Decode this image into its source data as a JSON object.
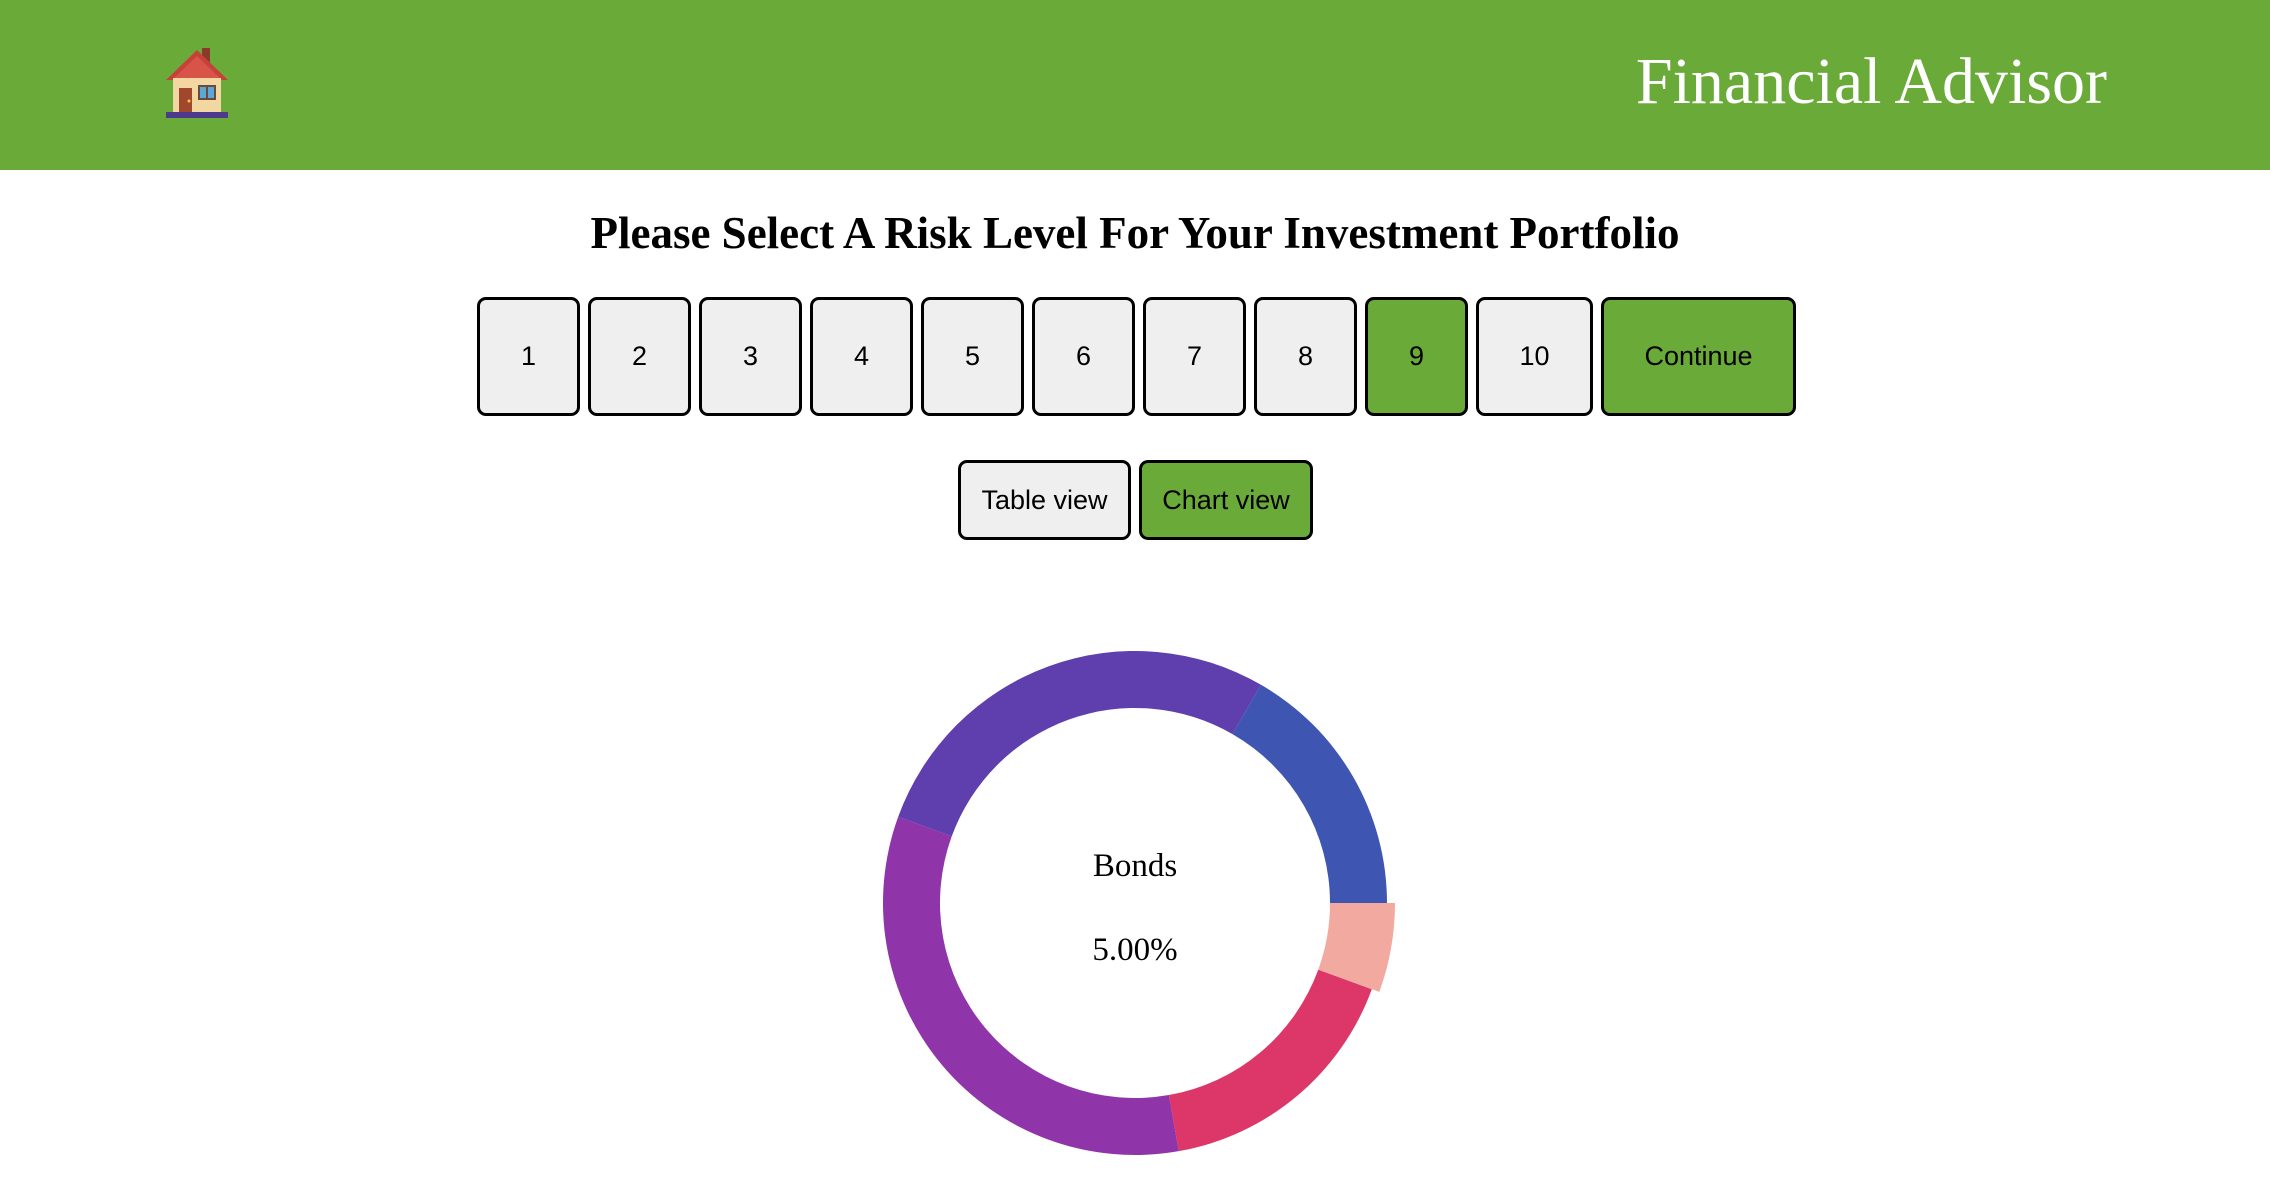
{
  "header": {
    "title": "Financial Advisor",
    "home_icon": "house-icon",
    "background_color": "#6aaa38"
  },
  "prompt": "Please Select A Risk Level For Your Investment Portfolio",
  "risk_levels": [
    "1",
    "2",
    "3",
    "4",
    "5",
    "6",
    "7",
    "8",
    "9",
    "10"
  ],
  "selected_risk_level": "9",
  "continue_label": "Continue",
  "views": {
    "table_label": "Table view",
    "chart_label": "Chart view",
    "active": "chart"
  },
  "chart_data": {
    "type": "pie",
    "style": "donut",
    "center_label": "Bonds",
    "center_value": "5.00%",
    "slices": [
      {
        "value": 5,
        "color": "#f2aaa0",
        "highlighted": true
      },
      {
        "value": 15,
        "color": "#dc3768"
      },
      {
        "value": 30,
        "color": "#9034aa"
      },
      {
        "value": 25,
        "color": "#5f3fae"
      },
      {
        "value": 15,
        "color": "#3e56b2"
      }
    ]
  }
}
